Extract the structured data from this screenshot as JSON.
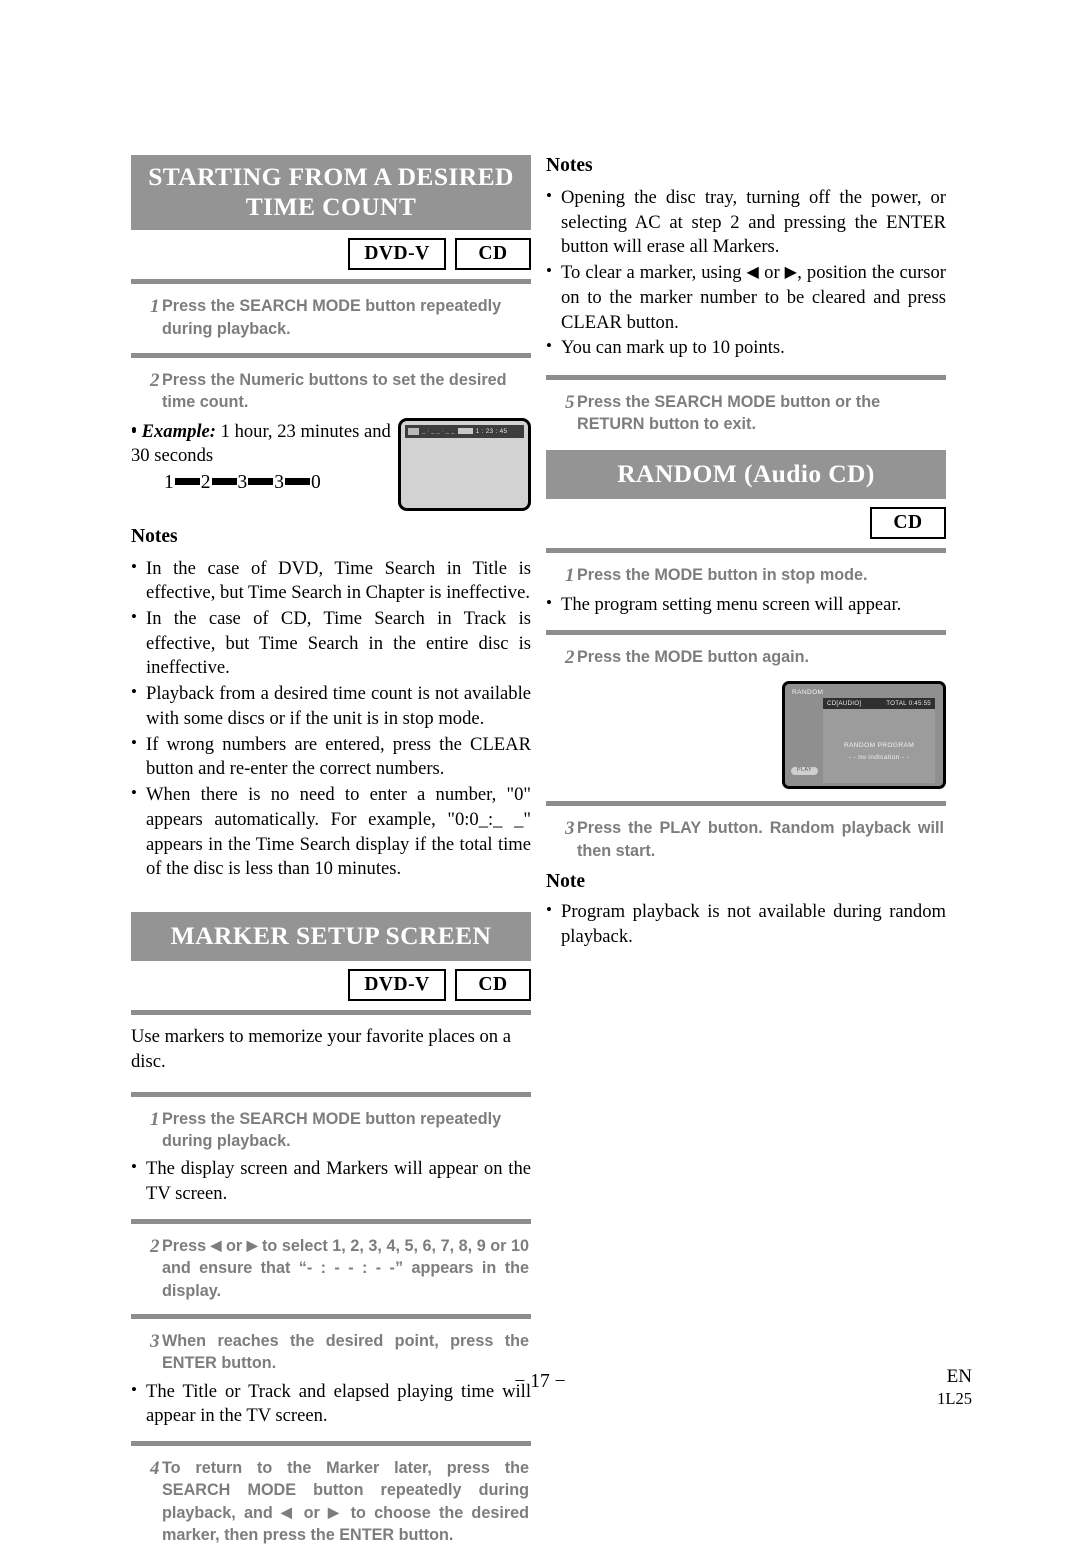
{
  "page": {
    "number_label": "− 17 −",
    "language_code": "EN",
    "doc_code": "1L25",
    "header_bar_color": "#949494",
    "rule_color": "#8d8d8d",
    "step_text_color": "#7d7d7d"
  },
  "left_column": {
    "section1": {
      "title_line1": "STARTING FROM A DESIRED",
      "title_line2": "TIME COUNT",
      "badges": [
        "DVD-V",
        "CD"
      ],
      "step1": {
        "num": "1",
        "text": "Press the SEARCH MODE button repeatedly during playback."
      },
      "step2": {
        "num": "2",
        "text": "Press the Numeric buttons to set the desired time count."
      },
      "example": {
        "label": "Example:",
        "text": "1 hour, 23 minutes and 30 seconds",
        "digits": [
          "1",
          "2",
          "3",
          "3",
          "0"
        ]
      },
      "tv_screen": {
        "osd_dashes": "_ : _ _ : _ _",
        "osd_time": "1 : 23 : 45"
      },
      "notes_label": "Notes",
      "notes": [
        "In the case of DVD, Time Search in Title is effective, but Time Search in Chapter is ineffective.",
        "In the case of CD, Time Search in Track is effective, but Time Search in the entire disc is ineffective.",
        "Playback from a desired time count is not available with some discs or if the unit is in stop mode.",
        "If wrong numbers are entered, press the CLEAR button and re-enter the correct numbers.",
        "When there is no need to enter a number, \"0\" appears automatically. For example, \"0:0_:_ _\" appears in the Time Search display if the total time of the disc is less than 10 minutes."
      ]
    },
    "section2": {
      "title": "MARKER SETUP SCREEN",
      "badges": [
        "DVD-V",
        "CD"
      ],
      "intro": "Use markers to memorize your favorite places on a disc.",
      "step1": {
        "num": "1",
        "text": "Press the SEARCH MODE button repeatedly during playback."
      },
      "step1_note": "The display screen and Markers will appear on the TV screen.",
      "step2": {
        "num": "2",
        "text_part1": "Press ",
        "text_part2": " or ",
        "text_part3": " to select 1, 2, 3, 4, 5, 6, 7, 8, 9 or 10 and ensure that “- : - - : - -” appears in the display."
      },
      "step3": {
        "num": "3",
        "text": "When reaches the desired point, press the ENTER button."
      },
      "step3_note": "The Title or Track and elapsed playing time will appear in the TV screen.",
      "step4": {
        "num": "4",
        "text_part1": "To return to the Marker later, press the SEARCH MODE button repeatedly during playback, and ",
        "text_part2": " or ",
        "text_part3": " to choose the desired marker, then press the ENTER button."
      }
    }
  },
  "right_column": {
    "notes_label": "Notes",
    "notes": [
      "Opening the disc tray, turning off the power, or selecting AC at step 2 and pressing the ENTER button will erase all Markers.",
      "You can mark up to 10 points."
    ],
    "note_clear_marker": {
      "part1": "To clear a marker, using ",
      "part2": " or ",
      "part3": ", position the cursor on to the marker number to be cleared and press CLEAR button."
    },
    "step5": {
      "num": "5",
      "text": "Press the SEARCH MODE button or the RETURN button to exit."
    },
    "section_random": {
      "title": "RANDOM (Audio CD)",
      "badges": [
        "CD"
      ],
      "step1": {
        "num": "1",
        "text": "Press the MODE button in stop mode."
      },
      "step1_note": "The program setting menu screen will appear.",
      "step2": {
        "num": "2",
        "text": "Press the MODE button again."
      },
      "random_screen": {
        "title": "RANDOM",
        "disc_label": "CD[AUDIO]",
        "total_label": "TOTAL  0:45:55",
        "center_line1": "RANDOM PROGRAM",
        "center_line2": "- - no indication - -",
        "play_badge": "PLAY"
      },
      "step3": {
        "num": "3",
        "text": "Press the PLAY button. Random playback will then start."
      },
      "note_label": "Note",
      "note": "Program playback is not available during random playback."
    }
  },
  "icons": {
    "arrow_left": "◀",
    "arrow_right": "▶"
  }
}
